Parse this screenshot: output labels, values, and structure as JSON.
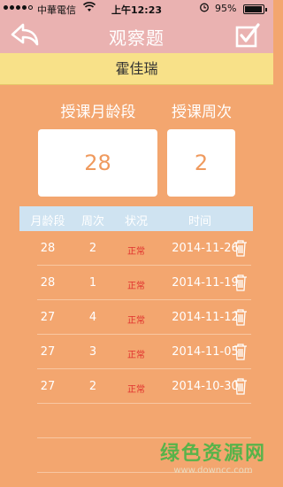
{
  "status_bar": {
    "carrier": "中華電信",
    "time": "上午12:23",
    "battery_text": "95%",
    "battery_level": 0.95
  },
  "nav": {
    "title": "观察题"
  },
  "student_name": "霍佳瑞",
  "course": {
    "age_label": "授课月龄段",
    "week_label": "授课周次",
    "age_value": "28",
    "week_value": "2"
  },
  "table": {
    "headers": [
      "月龄段",
      "周次",
      "状况",
      "时间"
    ],
    "rows": [
      {
        "age": "28",
        "week": "2",
        "status": "正常",
        "date": "2014-11-26"
      },
      {
        "age": "28",
        "week": "1",
        "status": "正常",
        "date": "2014-11-19"
      },
      {
        "age": "27",
        "week": "4",
        "status": "正常",
        "date": "2014-11-12"
      },
      {
        "age": "27",
        "week": "3",
        "status": "正常",
        "date": "2014-11-05"
      },
      {
        "age": "27",
        "week": "2",
        "status": "正常",
        "date": "2014-10-30"
      }
    ]
  },
  "watermark": {
    "title": "绿色资源网",
    "url": "www.downcc.com"
  },
  "colors": {
    "background": "#f3a66f",
    "nav_bar": "#eab2b1",
    "name_bar": "#f8e189",
    "table_header": "#cfe3f1",
    "status_text": "#e0302d",
    "watermark": "#58b34a"
  }
}
